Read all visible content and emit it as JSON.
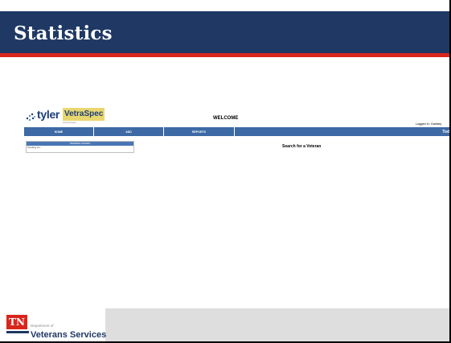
{
  "slide": {
    "title": "Statistics"
  },
  "embedded_app": {
    "logo": {
      "brand": "tyler",
      "product": "VetraSpec",
      "subtext": "technologies"
    },
    "welcome_text": "WELCOME",
    "logged_in_text": "Logged in: Gantary",
    "nav": {
      "items": [
        {
          "label": "HOME"
        },
        {
          "label": "ADD"
        },
        {
          "label": "REPORTS"
        },
        {
          "label": "Tod"
        }
      ]
    },
    "pending": {
      "title": "PENDING ISSUES",
      "items": [
        "Pending Inv..."
      ]
    },
    "search_title": "Search for a Veteran"
  },
  "footer": {
    "state_abbr": "TN",
    "dept_of": "Department of",
    "org_name": "Veterans Services"
  },
  "colors": {
    "header_bg": "#1f3864",
    "accent_red": "#d9261c",
    "nav_blue": "#3d6aa5"
  }
}
